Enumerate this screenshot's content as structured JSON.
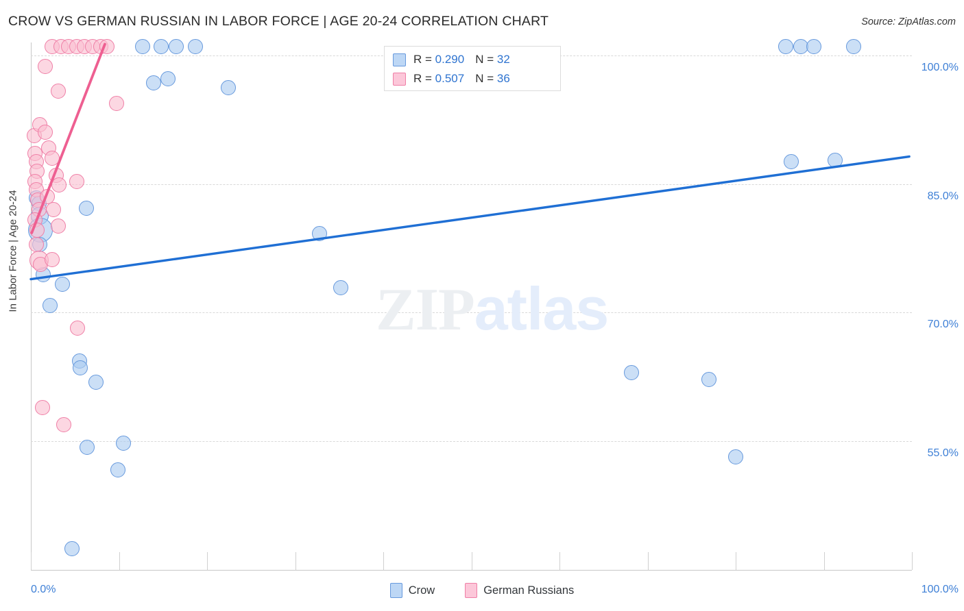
{
  "header": {
    "title": "CROW VS GERMAN RUSSIAN IN LABOR FORCE | AGE 20-24 CORRELATION CHART",
    "source": "Source: ZipAtlas.com"
  },
  "watermark": {
    "zip": "ZIP",
    "atlas": "atlas"
  },
  "stats_legend": {
    "rows": [
      {
        "series": "Crow",
        "color": "#bdd7f5",
        "r_label": "R = ",
        "r_value": "0.290",
        "n_label": "N = ",
        "n_value": "32"
      },
      {
        "series": "German Russians",
        "color": "#fcc7d9",
        "r_label": "R = ",
        "r_value": "0.507",
        "n_label": "N = ",
        "n_value": "36"
      }
    ]
  },
  "series_legend": [
    {
      "label": "Crow",
      "color": "#bdd7f5"
    },
    {
      "label": "German Russians",
      "color": "#fcc7d9"
    }
  ],
  "chart_data": {
    "type": "scatter",
    "title": "CROW VS GERMAN RUSSIAN IN LABOR FORCE | AGE 20-24 CORRELATION CHART",
    "xlabel": "",
    "ylabel": "In Labor Force | Age 20-24",
    "xlim": [
      0,
      100
    ],
    "ylim": [
      40.0,
      101.5
    ],
    "x_tick_labels": [
      "0.0%",
      "100.0%"
    ],
    "y_tick_labels": [
      "100.0%",
      "85.0%",
      "70.0%",
      "55.0%"
    ],
    "y_ticks": [
      100.0,
      85.0,
      70.0,
      55.0
    ],
    "grid": true,
    "legend_position": "bottom-center",
    "series": [
      {
        "name": "Crow",
        "color": "#bdd7f5",
        "edge_color": "#6699dd",
        "R": 0.29,
        "N": 32,
        "trendline": {
          "x0": 0.0,
          "y0": 73.9,
          "x1": 99.7,
          "y1": 88.2
        },
        "points": [
          {
            "x": 0.6,
            "y": 83.4,
            "r": 11
          },
          {
            "x": 0.9,
            "y": 82.7,
            "r": 11
          },
          {
            "x": 1.0,
            "y": 81.3,
            "r": 13
          },
          {
            "x": 1.1,
            "y": 79.6,
            "r": 18
          },
          {
            "x": 1.0,
            "y": 77.9,
            "r": 11
          },
          {
            "x": 1.4,
            "y": 74.4,
            "r": 11
          },
          {
            "x": 3.6,
            "y": 73.3,
            "r": 11
          },
          {
            "x": 2.2,
            "y": 70.8,
            "r": 11
          },
          {
            "x": 5.5,
            "y": 64.4,
            "r": 11
          },
          {
            "x": 5.6,
            "y": 63.6,
            "r": 11
          },
          {
            "x": 7.4,
            "y": 61.9,
            "r": 11
          },
          {
            "x": 6.4,
            "y": 54.3,
            "r": 11
          },
          {
            "x": 10.5,
            "y": 54.8,
            "r": 11
          },
          {
            "x": 9.9,
            "y": 51.7,
            "r": 11
          },
          {
            "x": 4.7,
            "y": 42.5,
            "r": 11
          },
          {
            "x": 6.3,
            "y": 82.2,
            "r": 11
          },
          {
            "x": 12.7,
            "y": 101.0,
            "r": 11
          },
          {
            "x": 14.8,
            "y": 101.0,
            "r": 11
          },
          {
            "x": 16.5,
            "y": 101.0,
            "r": 11
          },
          {
            "x": 18.7,
            "y": 101.0,
            "r": 11
          },
          {
            "x": 13.9,
            "y": 96.8,
            "r": 11
          },
          {
            "x": 15.6,
            "y": 97.3,
            "r": 11
          },
          {
            "x": 22.4,
            "y": 96.2,
            "r": 11
          },
          {
            "x": 32.8,
            "y": 79.2,
            "r": 11
          },
          {
            "x": 35.2,
            "y": 72.9,
            "r": 11
          },
          {
            "x": 68.2,
            "y": 63.0,
            "r": 11
          },
          {
            "x": 77.0,
            "y": 62.2,
            "r": 11
          },
          {
            "x": 80.0,
            "y": 53.2,
            "r": 11
          },
          {
            "x": 85.7,
            "y": 101.0,
            "r": 11
          },
          {
            "x": 87.4,
            "y": 101.0,
            "r": 11
          },
          {
            "x": 88.9,
            "y": 101.0,
            "r": 11
          },
          {
            "x": 93.4,
            "y": 101.0,
            "r": 11
          },
          {
            "x": 86.3,
            "y": 87.6,
            "r": 11
          },
          {
            "x": 91.3,
            "y": 87.8,
            "r": 11
          }
        ]
      },
      {
        "name": "German Russians",
        "color": "#fcc7d9",
        "edge_color": "#ef7ea6",
        "R": 0.507,
        "N": 36,
        "trendline": {
          "x0": 0.1,
          "y0": 79.3,
          "x1": 8.4,
          "y1": 101.3
        },
        "points": [
          {
            "x": 0.4,
            "y": 90.6,
            "r": 11
          },
          {
            "x": 0.5,
            "y": 88.6,
            "r": 11
          },
          {
            "x": 0.6,
            "y": 87.6,
            "r": 11
          },
          {
            "x": 0.7,
            "y": 86.5,
            "r": 11
          },
          {
            "x": 0.5,
            "y": 85.3,
            "r": 11
          },
          {
            "x": 0.6,
            "y": 84.3,
            "r": 11
          },
          {
            "x": 0.8,
            "y": 83.1,
            "r": 11
          },
          {
            "x": 0.9,
            "y": 82.0,
            "r": 11
          },
          {
            "x": 0.5,
            "y": 80.8,
            "r": 11
          },
          {
            "x": 0.7,
            "y": 79.6,
            "r": 11
          },
          {
            "x": 0.6,
            "y": 77.9,
            "r": 11
          },
          {
            "x": 0.9,
            "y": 76.1,
            "r": 14
          },
          {
            "x": 1.1,
            "y": 75.6,
            "r": 11
          },
          {
            "x": 1.0,
            "y": 91.9,
            "r": 11
          },
          {
            "x": 1.6,
            "y": 91.0,
            "r": 11
          },
          {
            "x": 2.0,
            "y": 89.2,
            "r": 11
          },
          {
            "x": 2.4,
            "y": 88.0,
            "r": 11
          },
          {
            "x": 2.9,
            "y": 86.0,
            "r": 11
          },
          {
            "x": 3.2,
            "y": 84.9,
            "r": 11
          },
          {
            "x": 1.9,
            "y": 83.5,
            "r": 11
          },
          {
            "x": 2.6,
            "y": 82.0,
            "r": 11
          },
          {
            "x": 3.1,
            "y": 80.1,
            "r": 11
          },
          {
            "x": 2.4,
            "y": 76.2,
            "r": 11
          },
          {
            "x": 5.2,
            "y": 85.3,
            "r": 11
          },
          {
            "x": 5.3,
            "y": 68.2,
            "r": 11
          },
          {
            "x": 1.3,
            "y": 58.9,
            "r": 11
          },
          {
            "x": 3.7,
            "y": 56.9,
            "r": 11
          },
          {
            "x": 1.6,
            "y": 98.7,
            "r": 11
          },
          {
            "x": 3.1,
            "y": 95.8,
            "r": 11
          },
          {
            "x": 9.7,
            "y": 94.4,
            "r": 11
          },
          {
            "x": 2.4,
            "y": 101.0,
            "r": 11
          },
          {
            "x": 3.4,
            "y": 101.0,
            "r": 11
          },
          {
            "x": 4.3,
            "y": 101.0,
            "r": 11
          },
          {
            "x": 5.2,
            "y": 101.0,
            "r": 11
          },
          {
            "x": 6.1,
            "y": 101.0,
            "r": 11
          },
          {
            "x": 7.0,
            "y": 101.0,
            "r": 11
          },
          {
            "x": 7.9,
            "y": 101.0,
            "r": 11
          },
          {
            "x": 8.6,
            "y": 101.0,
            "r": 11
          }
        ]
      }
    ]
  }
}
